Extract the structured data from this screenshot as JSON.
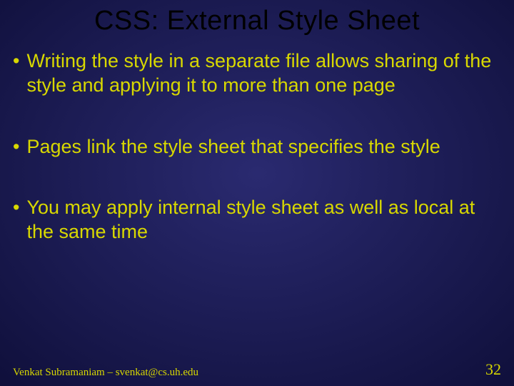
{
  "title": "CSS: External Style Sheet",
  "bullets": [
    "Writing the style in a separate file allows sharing of the style and applying it to more than one page",
    "Pages link the style sheet that specifies the style",
    "You may apply internal style sheet as well as local at the same time"
  ],
  "footer": {
    "author": "Venkat Subramaniam – svenkat@cs.uh.edu",
    "page": "32"
  }
}
